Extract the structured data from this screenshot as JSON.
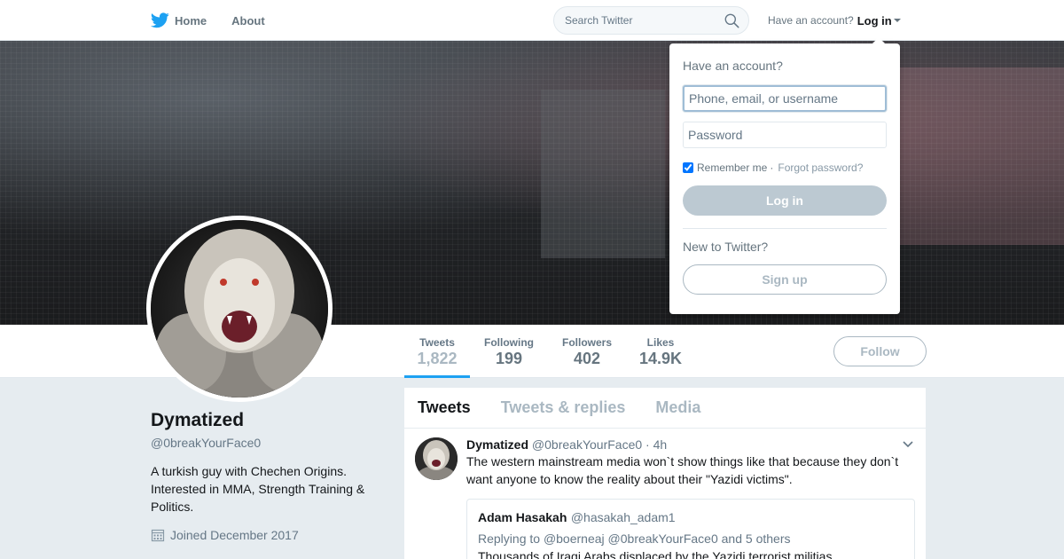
{
  "nav": {
    "home_label": "Home",
    "about_label": "About",
    "search_placeholder": "Search Twitter",
    "have_account_text": "Have an account?",
    "login_label": "Log in"
  },
  "profile": {
    "name": "Dymatized",
    "handle": "@0breakYourFace0",
    "bio": "A turkish guy with Chechen Origins. Interested in MMA, Strength Training & Politics.",
    "joined": "Joined December 2017"
  },
  "stats": [
    {
      "label": "Tweets",
      "value": "1,822"
    },
    {
      "label": "Following",
      "value": "199"
    },
    {
      "label": "Followers",
      "value": "402"
    },
    {
      "label": "Likes",
      "value": "14.9K"
    }
  ],
  "follow_label": "Follow",
  "timeline": {
    "tabs": [
      "Tweets",
      "Tweets & replies",
      "Media"
    ],
    "tweet": {
      "name": "Dymatized",
      "handle": "@0breakYourFace0",
      "time": "· 4h",
      "text": "The western mainstream media won`t show things like that because they don`t want anyone to know the reality about their \"Yazidi victims\".",
      "quote": {
        "name": "Adam Hasakah",
        "handle": "@hasakah_adam1",
        "replying_prefix": "Replying to",
        "mention1": "@boerneaj",
        "mention2": "@0breakYourFace0",
        "replying_suffix": "and 5 others",
        "text": "Thousands of Iraqi Arabs displaced by the Yazidi terrorist militias"
      }
    }
  },
  "login_dropdown": {
    "title": "Have an account?",
    "username_placeholder": "Phone, email, or username",
    "password_placeholder": "Password",
    "remember_label": "Remember me",
    "separator": "·",
    "forgot_label": "Forgot password?",
    "login_button": "Log in",
    "new_text": "New to Twitter?",
    "signup_button": "Sign up"
  },
  "colors": {
    "accent": "#1da1f2",
    "background": "#e6ecf0",
    "muted": "#657786"
  }
}
